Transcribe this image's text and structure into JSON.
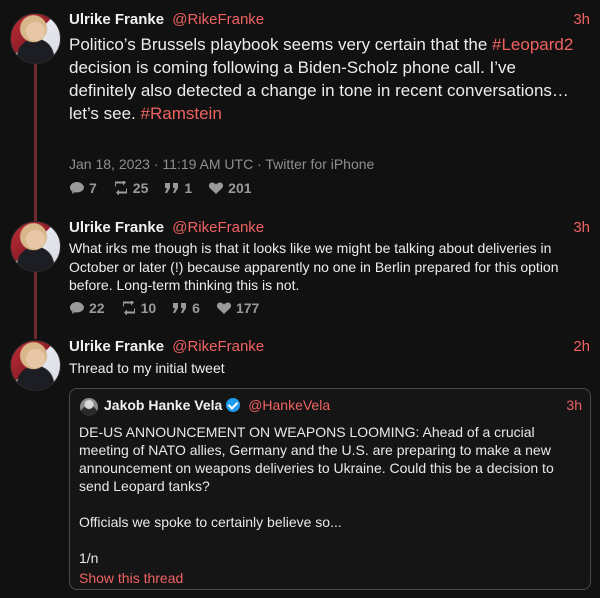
{
  "tweets": [
    {
      "name": "Ulrike Franke",
      "handle": "@RikeFranke",
      "time": "3h",
      "text_parts": [
        "Politico’s Brussels playbook seems very certain that the ",
        "#Leopard2",
        " decision is coming following a Biden-Scholz phone call. I’ve definitely also detected a change in tone in recent conversations… let’s see. ",
        "#Ramstein"
      ],
      "meta": "Jan 18, 2023 · 11:19 AM UTC · Twitter for iPhone",
      "replies": "7",
      "retweets": "25",
      "quotes": "1",
      "likes": "201"
    },
    {
      "name": "Ulrike Franke",
      "handle": "@RikeFranke",
      "time": "3h",
      "text": "What irks me though is that it looks like we might be talking about deliveries in October or later (!) because apparently no one in Berlin prepared for this option before. Long-term thinking this is not.",
      "replies": "22",
      "retweets": "10",
      "quotes": "6",
      "likes": "177"
    },
    {
      "name": "Ulrike Franke",
      "handle": "@RikeFranke",
      "time": "2h",
      "text": "Thread to my initial tweet"
    }
  ],
  "quote": {
    "name": "Jakob Hanke Vela",
    "handle": "@HankeVela",
    "time": "3h",
    "text": "DE-US ANNOUNCEMENT ON WEAPONS LOOMING: Ahead of a crucial meeting of NATO allies, Germany and the U.S. are preparing to make a new announcement on weapons deliveries to Ukraine. Could this be a decision to send Leopard tanks?\n\nOfficials we spoke to certainly believe so...\n\n1/n",
    "link": "Show this thread"
  },
  "colors": {
    "accent": "#f06262",
    "background": "#111111",
    "thread_line": "#6f2b2f"
  },
  "icons": [
    "reply-icon",
    "retweet-icon",
    "quote-icon",
    "heart-icon",
    "verified-badge-icon"
  ]
}
